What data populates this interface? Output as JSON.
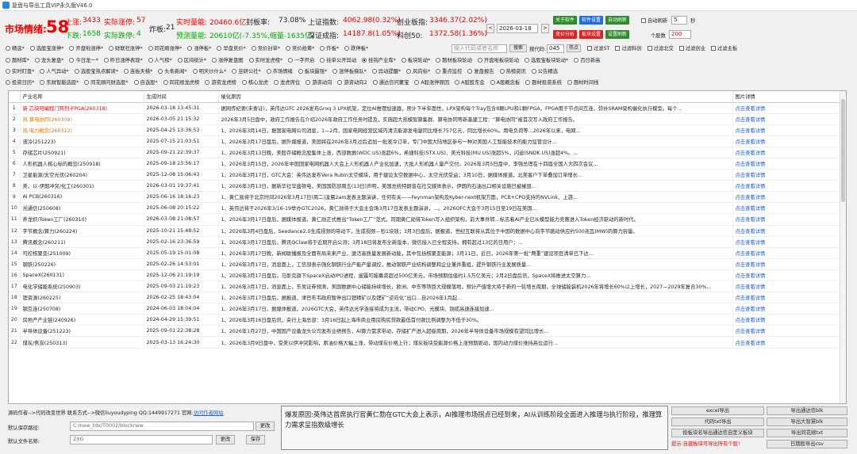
{
  "window": {
    "title": "复盘与导出工具VIP永久版V46.0"
  },
  "stats": {
    "sentiment_label": "市场情绪:",
    "sentiment_value": "58",
    "up_label": "上涨:",
    "up_value": "3433",
    "limit_up_label": "实际涨停:",
    "limit_up_value": "57",
    "down_label": "下跌:",
    "down_value": "1658",
    "limit_down_label": "实际跌停:",
    "limit_down_value": "4",
    "bomb_label": "炸板:",
    "bomb_value": "21",
    "realtime_vol_label": "实时量能:",
    "realtime_vol_value": "20460.6亿",
    "seal_rate_label": "封板率:",
    "seal_rate_value": "73.08%",
    "forecast_label": "预测量能:",
    "forecast_value": "20610亿(-7.35%,缩量-1635亿)",
    "sh_label": "上证指数:",
    "sh_value": "4062.98(0.32%)",
    "cyb_label": "创业板指:",
    "cyb_value": "3346.37(2.02%)",
    "sz_label": "深证成指:",
    "sz_value": "14187.8(1.05%)",
    "kc_label": "科创50:",
    "kc_value": "1372.58(1.36%)"
  },
  "controls": {
    "date": "2026-03-18",
    "prev": "<",
    "next": ">",
    "btn_focus": "关于软件",
    "btn_update": "软件设置",
    "btn_auto": "自动刷新",
    "btn_popup": "竞价分析",
    "btn_capital": "板块设置",
    "btn_refresh": "设置刷新",
    "auto_refresh": "自动刷新",
    "interval_value": "5",
    "interval_unit": "秒",
    "stock_count_label": "个股数",
    "stock_count_value": "200",
    "search_placeholder": "输入代码或者名称",
    "search_btn": "搜索",
    "search_code_label": "搜代码:",
    "search_code_value": "045",
    "hot_btn": "热点"
  },
  "filters": {
    "row1": [
      "精选*",
      "选股宝涨停*",
      "开盘啦涨停*",
      "财联社涨停*",
      "同花顺涨停*",
      "涨停板*",
      "早盘竞价*",
      "竞价封单*",
      "竞价抢筹*",
      "炸板*",
      "跌停板*"
    ],
    "row1_checks": [
      "过滤ST",
      "过滤科创",
      "过滤北交",
      "过滤创业",
      "过滤主板"
    ],
    "row2": [
      "题材库*",
      "龙头复盘*",
      "今日龙一*",
      "昨日涨停表现*",
      "人气榜*",
      "区间统计*",
      "涨停复盘图",
      "实时龙虎榜*",
      "一字开启",
      "挂单公开异动",
      "挂钩产业库*",
      "板块轮动*",
      "题材板块轮动",
      "开盘啦板块轮动",
      "选股宝板块轮动*",
      "百日新高"
    ],
    "row3": [
      "实时盯盘*",
      "人气异动*",
      "选股宝热点解读*",
      "连板天梯*",
      "头条新闻*",
      "明天炒什么*",
      "韭研公社*",
      "市场情绪",
      "板块最强*",
      "涨停板梯队*",
      "异动提醒*",
      "风向标*",
      "重点监控",
      "复盘报告",
      "热榜资讯",
      "公告精选"
    ],
    "row4": [
      "投资日历*",
      "东财智能选股*",
      "同花顺问财选股*",
      "自选股*",
      "同花顺龙虎榜",
      "游资龙虎榜",
      "核心龙虎",
      "龙虎席位",
      "游资动向",
      "游资动向2",
      "通达信问董宝",
      "A股涨停原因",
      "A股股东会",
      "A股概念板",
      "题材投资系统",
      "题材时间线"
    ],
    "selected": "挂钩产业库*"
  },
  "table": {
    "headers": [
      "",
      "产业名称",
      "生成时间",
      "催化原因",
      "图片详情"
    ],
    "rows": [
      {
        "name": "新 芯块可编程门阵列-FPGA(260318)",
        "time": "2026-03-18 13:45:31",
        "reason": "据网传纪要(未查证)，英伟达GTC 2026发布Groq 3 LPX机架，定位AI推理加速器，预计下半年面世。LPX架构每个Tray包含8颗LPU和1颗FPGA，FPGA用于节点间互连，弥补SRAM架构催化执行模型。每个...",
        "link": "点击查看详情"
      },
      {
        "name": "热 算电协同(260309)",
        "time": "2026-03-05 21:15:32",
        "reason": "2026年3月5日盘中，政府工作报告在介绍2026年政府工作任务时提及，实施超大规模智算集群、算电协同等新基建工程：“算电协同”被首次写入政府工作报告。",
        "link": "点击查看详情"
      },
      {
        "name": "热 电力概念(260312)",
        "time": "2025-04-25 13:36:53",
        "reason": "1、2026年3月14日，据国家电网公司消息，1—2月，国家电网经营区域内清洁能源发电量同比增长757亿元，同比增长60%。用电负荷等...2026年以来，电网...",
        "link": "点击查看详情"
      },
      {
        "name": "液冷(251223)",
        "time": "2025-07-15 21:03:51",
        "reason": "1、2026年3月17日盘后，据外媒报道，美国将在2026年3月过后追加一批液冷订单，专门中国大陆地区参与一种对美国人工智能技术的能力监管设计...",
        "link": "点击查看详情"
      },
      {
        "name": "存储芯片(250921)",
        "time": "2025-09-21 22:39:37",
        "reason": "1、2026年3月13日晚，美股存储概念股集体上涨，西部数据(WDC.US)涨超6%，希捷科技(STX.US)、美光科技(MU.US)涨超5%，闪迪(SNDK.US)涨超4%。...",
        "link": "点击查看详情"
      },
      {
        "name": "人形机器人核心标的概览(250918)",
        "time": "2025-09-18 23:56:17",
        "reason": "1、2026年3月15日，2026年中国国家电网机器人大会上人形机器人产业化加速，大批人形机器人量产交付。2026年3月5日盘中，李强总理在十四届全国人大四次会议...",
        "link": "点击查看详情"
      },
      {
        "name": "卫星能源/太空光伏(260204)",
        "time": "2025-12-08 15:06:43",
        "reason": "1、2026年3月17日，GTC大会：英伟达发布Vera Rubin太空模块，用于建设太空数据中心，太空光伏受益；3月10日，据媒体报道，北美客户下单叠加订单增长...",
        "link": "点击查看详情"
      },
      {
        "name": "美、以-伊朗冲突/化工(260301)",
        "time": "2026-03-01 19:37:41",
        "reason": "1、2026年3月13日，据新华社华盛顿电，美国国防部周五(13日)声明，美国总统特朗普在社交媒体表示，伊朗的石油出口相关设施已被摧毁...",
        "link": "点击查看详情"
      },
      {
        "name": "AI PCB(260316)",
        "time": "2025-06-16 18:16:23",
        "reason": "1、黄仁勋将于北京时间2026年3月17日(周二)凌晨2am发表主题演讲，任何有关——Feynman架构及Kyber-next机架方面，PCB+CPO支持的NVLink、上游...",
        "link": "点击查看详情"
      },
      {
        "name": "光通信(250608)",
        "time": "2025-06-08 20:15:22",
        "reason": "1、英伟达将于2026年3/16-19举办GTC2026，黄仁勋将于大会主会场3月17日发表主题演讲，...。2026OFC大会于3月15日至19日在美国...",
        "link": "点击查看详情"
      },
      {
        "name": "养龙虾/Token工厂(260310)",
        "time": "2026-03-08 21:08:57",
        "reason": "1、2026年3月17日盘后，据媒体报道，黄仁勋正式推出“Token工厂”范式，同期黄仁勋将Token写入组织架构，前大事件转...标志着AI产业已从模型能力竞赛进入Token经济驱动的新时代。",
        "link": "点击查看详情"
      },
      {
        "name": "字节概念/算力(260224)",
        "time": "2025-10-21 15:48:52",
        "reason": "1、2026年3月4日盘后，Seedance2.0生成视频的带动下，生成视频—秒1块钱；3月3日盘后，据报道，世纪互联将从其位于中国的数据中心向字节跳动供应约500兆瓦(MW)的算力容量。",
        "link": "点击查看详情"
      },
      {
        "name": "腾讯概念(260211)",
        "time": "2025-02-16 23:36:59",
        "reason": "1、2026年3月17日盘后，腾讯QClaw将于近期开启公测；3月18日将发布全新版本，微信接入已全程支持，拥有超过13亿的日用户；...",
        "link": "点击查看详情"
      },
      {
        "name": "可控核聚变(251009)",
        "time": "2025-05-19 15:01:08",
        "reason": "1、2026年3月17日晚，新闻联播报及全面布局未来产业，激活高质量发展新动能，其中包括核聚变能源；3月11日，近日，2026年第一批“两重”建设项目清单已下达...",
        "link": "点击查看详情"
      },
      {
        "name": "钢铁(250226)",
        "time": "2025-02-26 14:53:01",
        "reason": "1、2026年3月17日，消息面上，工信部表示强化钢铁行业产能产量调控，推动钢铁产业结构调整和企业兼并重组，提升钢铁行业发展质量...",
        "link": "点击查看详情"
      },
      {
        "name": "SpaceX(260131)",
        "time": "2025-12-06 21:19:19",
        "reason": "1、2026年3月17日盘后，马斯克旗下SpaceX启动IPO进程，披露可能募资超过500亿美元，市场预期估值约1.5万亿美元；2月2日盘后讯，SpaceX将推进太空算力...",
        "link": "点击查看详情"
      },
      {
        "name": "电化学储能系统(250903)",
        "time": "2025-09-03 21:19:23",
        "reason": "1、2026年3月17日，消息面上，东吴证券预测，美国数据中心储能持续增长，欧洲、中东等项目大规模落地，预计产值增大将于新的一轮增长周期，全球储能装机2026年将增长60%以上增长，2027—2029年复合30%...",
        "link": "点击查看详情"
      },
      {
        "name": "锂资源(260225)",
        "time": "2026-02-25 18:43:04",
        "reason": "1、2026年3月17日盘后，据报道，津巴布韦政府暂停出口锂精矿以及锂矿“逆向化”出口...自2026年1月起...",
        "link": "点击查看详情"
      },
      {
        "name": "钢互连(250708)",
        "time": "2024-06-03 18:04:04",
        "reason": "1、2026年3月17日，据媒体报道，2026GTC大会，英伟达光学连接将成为主流，带动CPO、光模块、铜缆高速连接加速...",
        "link": "点击查看详情"
      },
      {
        "name": "房地产产业链(240926)",
        "time": "2024-04-29 15:39:51",
        "reason": "1、2026年3月16日盘后讯，央行上海总部：3月16日起上海市商业用房购房贷款最低首付款比例调整为不低于30%。",
        "link": "点击查看详情"
      },
      {
        "name": "半导体设备(251223)",
        "time": "2025-09-01 22:38:28",
        "reason": "1、2026年1月27日，中国国产设备龙头公司发布业绩预告，AI算力需求带动，存储扩产进入超级周期，2026年半导体设备市场规模有望同比增长...",
        "link": "点击查看详情"
      },
      {
        "name": "煤炭/焦炭(250313)",
        "time": "2025-03-13 16:24:30",
        "reason": "1、2026年3月9日盘中，受美以伊冲突影响，原油价格大幅上涨，带动煤炭价格上行；煤炭板块受能源价格上涨预期驱动，国内动力煤价维持高位运行...",
        "link": "点击查看详情"
      }
    ]
  },
  "footer": {
    "contact": "源码作者-->代码改变世界 联系方式-->微信liuyoudyping QQ:1449917271 官网:",
    "site": "访问作者网站",
    "save_path_label": "默认保存路径:",
    "save_path_value": "C:/new_tdx/T0002/blocknew",
    "change_btn": "更改",
    "filename_label": "默认文件名称:",
    "filename_value": "ZXG",
    "rename_btn": "更改",
    "save_btn": "保存",
    "info": "爆发原因:英伟达首席执行官黄仁勋在GTC大会上表示，AI推理市场拐点已经到来，AI从训练阶段全面进入推理与执行阶段，推理算力需求呈指数级增长",
    "btn_excel": "excel导出",
    "btn_txt": "代码txt导出",
    "btn_block": "按板块名导出通达信自定义板块",
    "btn_tdx": "导出通达信blk",
    "btn_dzh": "导出大智慧blk",
    "btn_ths": "导出同花顺txt",
    "btn_csv": "日期股导出csv",
    "warn": "提示:自建板块可导出所有个股!"
  }
}
